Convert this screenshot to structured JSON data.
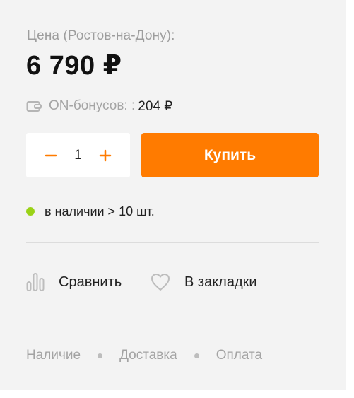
{
  "price": {
    "label": "Цена (Ростов-на-Дону):",
    "value": "6 790 ₽"
  },
  "bonus": {
    "icon": "wallet-icon",
    "label": "ON-бонусов: :",
    "value": "204 ₽"
  },
  "quantity": {
    "value": "1",
    "decrease_icon": "minus-icon",
    "increase_icon": "plus-icon"
  },
  "buy_button": {
    "label": "Купить"
  },
  "stock": {
    "text": "в наличии > 10 шт.",
    "status_color": "#9ad217"
  },
  "actions": {
    "compare": {
      "label": "Сравнить",
      "icon": "compare-bars-icon"
    },
    "bookmark": {
      "label": "В закладки",
      "icon": "heart-icon"
    }
  },
  "footer": {
    "links": [
      "Наличие",
      "Доставка",
      "Оплата"
    ]
  },
  "colors": {
    "accent": "#ff7b00",
    "panel_bg": "#f3f3f3"
  }
}
